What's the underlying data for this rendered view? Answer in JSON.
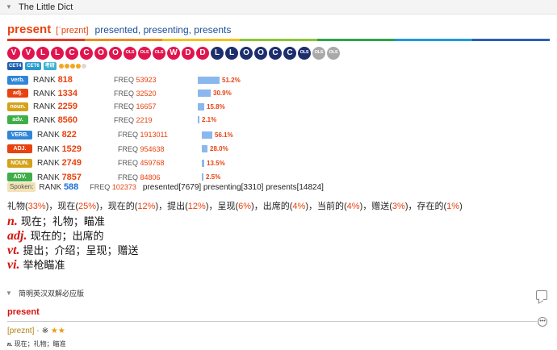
{
  "header": {
    "title": "The Little Dict"
  },
  "entry": {
    "headword": "present",
    "phonetic": "[ˈpreznt]",
    "forms": "presented, presenting, presents"
  },
  "rainbow_colors": [
    "#e03b24",
    "#f08a1d",
    "#f4c21a",
    "#8cc43a",
    "#2aa64a",
    "#1e9bd6",
    "#2b5fb7"
  ],
  "circles": [
    {
      "label": "V",
      "color": "#e0154f"
    },
    {
      "label": "V",
      "color": "#e0154f"
    },
    {
      "label": "L",
      "color": "#e0154f"
    },
    {
      "label": "L",
      "color": "#e0154f"
    },
    {
      "label": "C",
      "color": "#e0154f"
    },
    {
      "label": "C",
      "color": "#e0154f"
    },
    {
      "label": "O",
      "color": "#e0154f"
    },
    {
      "label": "O",
      "color": "#e0154f"
    },
    {
      "label": "OLS",
      "color": "#e0154f",
      "small": true
    },
    {
      "label": "OLS",
      "color": "#e0154f",
      "small": true
    },
    {
      "label": "OLS",
      "color": "#e0154f",
      "small": true
    },
    {
      "label": "W",
      "color": "#e0154f"
    },
    {
      "label": "D",
      "color": "#e0154f"
    },
    {
      "label": "D",
      "color": "#e0154f"
    },
    {
      "label": "L",
      "color": "#1c2e6e"
    },
    {
      "label": "L",
      "color": "#1c2e6e"
    },
    {
      "label": "O",
      "color": "#1c2e6e"
    },
    {
      "label": "O",
      "color": "#1c2e6e"
    },
    {
      "label": "C",
      "color": "#1c2e6e"
    },
    {
      "label": "C",
      "color": "#1c2e6e"
    },
    {
      "label": "OLS",
      "color": "#1c2e6e",
      "small": true
    },
    {
      "label": "OLS",
      "color": "#a9a9a9",
      "small": true
    },
    {
      "label": "OLS",
      "color": "#a9a9a9",
      "small": true
    }
  ],
  "tags": [
    {
      "label": "CET4",
      "color": "#1c5fae"
    },
    {
      "label": "CET6",
      "color": "#2a9ad0"
    },
    {
      "label": "考研",
      "color": "#3db0d2"
    }
  ],
  "star_dots": [
    "#f4a61d",
    "#f4a61d",
    "#f4a61d",
    "#f4a61d",
    "#d9d9d9"
  ],
  "pos_ranks_1": [
    {
      "pos": "verb.",
      "color": "#2f86d8",
      "rank_label": "RANK",
      "rank": "818",
      "freq_label": "FREQ",
      "freq": "53923",
      "pct": "51.2%",
      "share": 0.512
    },
    {
      "pos": "adj.",
      "color": "#e8430f",
      "rank_label": "RANK",
      "rank": "1334",
      "freq_label": "FREQ",
      "freq": "32520",
      "pct": "30.9%",
      "share": 0.309
    },
    {
      "pos": "noun.",
      "color": "#d4a21a",
      "rank_label": "RANK",
      "rank": "2259",
      "freq_label": "FREQ",
      "freq": "16657",
      "pct": "15.8%",
      "share": 0.158
    },
    {
      "pos": "adv.",
      "color": "#3fae49",
      "rank_label": "RANK",
      "rank": "8560",
      "freq_label": "FREQ",
      "freq": "2219",
      "pct": "2.1%",
      "share": 0.021
    }
  ],
  "pos_ranks_2": [
    {
      "pos": "VERB.",
      "color": "#2f86d8",
      "rank_label": "RANK",
      "rank": "822",
      "freq_label": "FREQ",
      "freq": "1913011",
      "pct": "56.1%",
      "share": 0.561
    },
    {
      "pos": "ADJ.",
      "color": "#e8430f",
      "rank_label": "RANK",
      "rank": "1529",
      "freq_label": "FREQ",
      "freq": "954638",
      "pct": "28.0%",
      "share": 0.28
    },
    {
      "pos": "NOUN.",
      "color": "#d4a21a",
      "rank_label": "RANK",
      "rank": "2749",
      "freq_label": "FREQ",
      "freq": "459768",
      "pct": "13.5%",
      "share": 0.135
    },
    {
      "pos": "ADV.",
      "color": "#3fae49",
      "rank_label": "RANK",
      "rank": "7857",
      "freq_label": "FREQ",
      "freq": "84806",
      "pct": "2.5%",
      "share": 0.025
    }
  ],
  "spoken": {
    "tag": "Spoken:",
    "rank_label": "RANK",
    "rank": "588",
    "freq_label": "FREQ",
    "freq": "102373",
    "forms": "presented[7679] presenting[3310] presents[14824]"
  },
  "translations": [
    {
      "word": "礼物",
      "pct": "33%"
    },
    {
      "word": "现在",
      "pct": "25%"
    },
    {
      "word": "现在的",
      "pct": "12%"
    },
    {
      "word": "提出",
      "pct": "12%"
    },
    {
      "word": "呈现",
      "pct": "6%"
    },
    {
      "word": "出席的",
      "pct": "4%"
    },
    {
      "word": "当前的",
      "pct": "4%"
    },
    {
      "word": "赠送",
      "pct": "3%"
    },
    {
      "word": "存在的",
      "pct": "1%"
    }
  ],
  "definitions": [
    {
      "pos": "n.",
      "meaning": "现在；礼物；瞄准"
    },
    {
      "pos": "adj.",
      "meaning": "现在的；出席的"
    },
    {
      "pos": "vt.",
      "meaning": "提出；介绍；呈现；赠送"
    },
    {
      "pos": "vi.",
      "meaning": "举枪瞄准"
    }
  ],
  "section2": {
    "title": "简明英汉双解必应版",
    "headword": "present",
    "phonetic": "[preznt]",
    "dash": "-",
    "marker": "※",
    "stars": "★★",
    "def_pos": "n.",
    "def_text": "现在；礼物；瞄准"
  }
}
